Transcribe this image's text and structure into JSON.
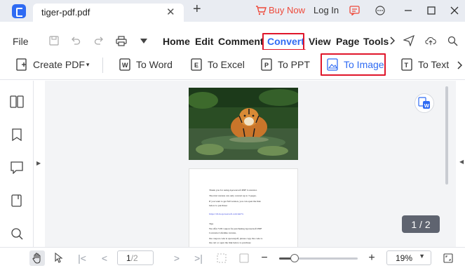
{
  "tab": {
    "title": "tiger-pdf.pdf"
  },
  "topbar": {
    "buy_now": "Buy Now",
    "login": "Log In"
  },
  "menu": {
    "file": "File",
    "items": [
      "Home",
      "Edit",
      "Comment",
      "Convert",
      "View",
      "Page",
      "Tools"
    ],
    "active": "Convert"
  },
  "toolbar": {
    "create_pdf": "Create PDF",
    "to_word": "To Word",
    "to_excel": "To Excel",
    "to_ppt": "To PPT",
    "to_image": "To Image",
    "to_text": "To Text"
  },
  "document": {
    "page_indicator": "1 / 2",
    "page2_lines": [
      "Thank you for using Apowersoft PDF Converter.",
      "The trial version can only convert up to 3 pages.",
      "If you want to get full version, you can open the link",
      "below to purchase:",
      "https://click.apowersoft.com/del?l=",
      "Tips",
      "We offer VIP coupon for purchasing Apowersoft PDF",
      "Converter Lifetime version,",
      "the coupon code is apowerpdf, please copy the code to",
      "the cart or open the link below to purchase"
    ]
  },
  "statusbar": {
    "current_page": "1",
    "total_pages": "/2",
    "zoom": "19%",
    "zoom_level_fraction": 0.2
  },
  "colors": {
    "accent": "#2f6bf3",
    "highlight": "#e0162b",
    "buy_now": "#ee4a3b"
  }
}
